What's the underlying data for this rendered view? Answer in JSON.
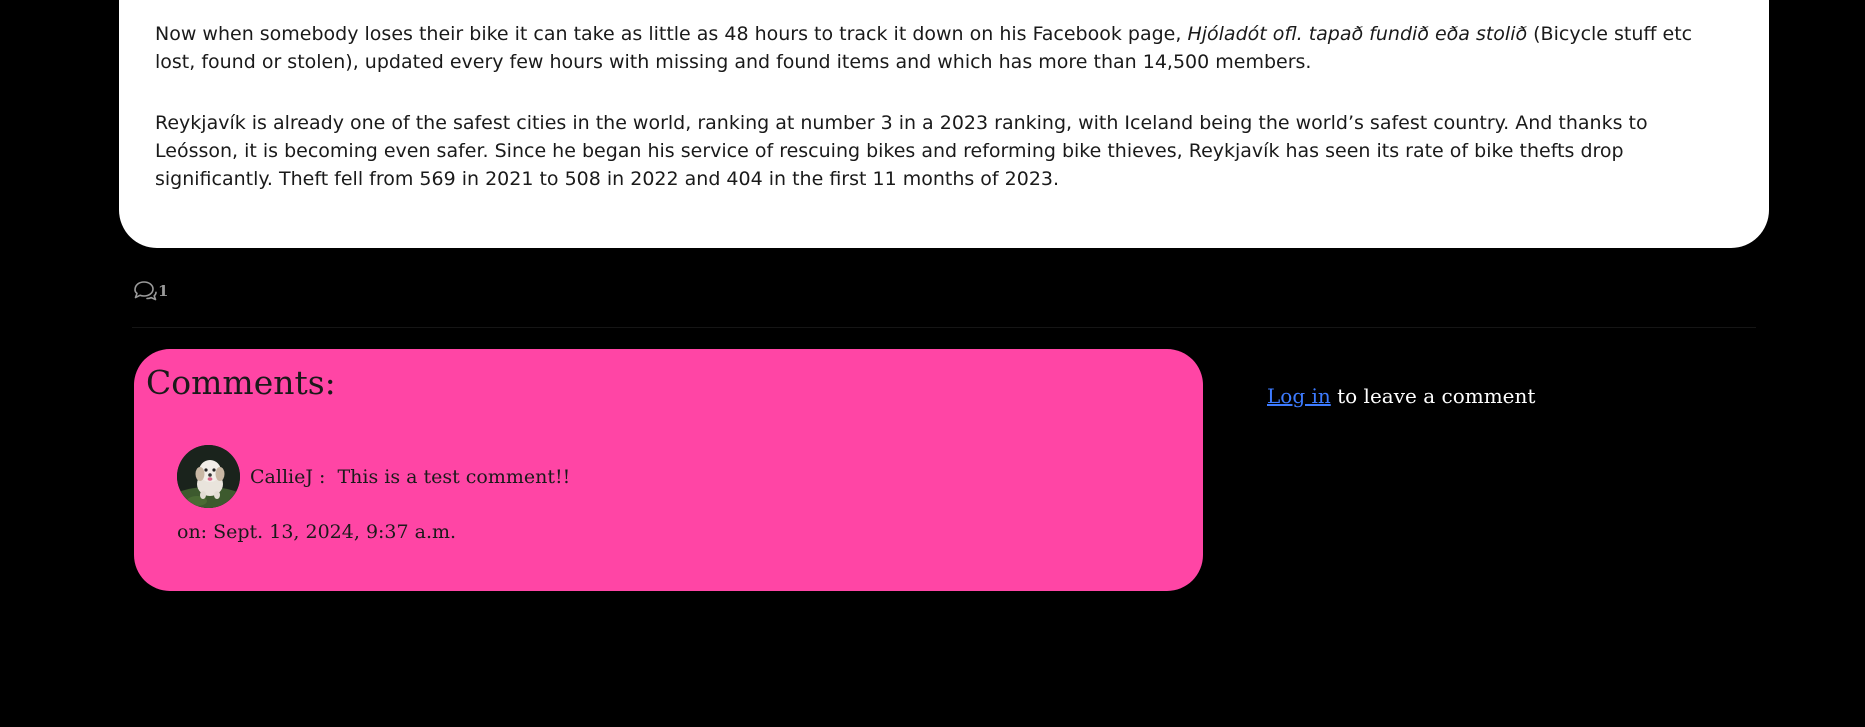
{
  "article": {
    "p1_before": "Now when somebody loses their bike it can take as little as 48 hours to track it down on his Facebook page, ",
    "p1_italic": "Hjóladót ofl. tapað fundið eða stolið",
    "p1_after": " (Bicycle stuff etc lost, found or stolen), updated every few hours with missing and found items and which has more than 14,500 members.",
    "p2": "Reykjavík is already one of the safest cities in the world, ranking at number 3 in a 2023 ranking, with Iceland being the world’s safest country. And thanks to Leósson, it is becoming even safer. Since he began his service of rescuing bikes and reforming bike thieves, Reykjavík has seen its rate of bike thefts drop significantly. Theft fell from 569 in 2021 to 508 in 2022 and 404 in the first 11 months of 2023."
  },
  "comment_count": {
    "icon": "comments-icon",
    "value": "1"
  },
  "comments": {
    "title": "Comments:",
    "items": [
      {
        "text": "CallieJ :  This is a test comment!!",
        "date": "on: Sept. 13, 2024, 9:37 a.m.",
        "avatar": "dog-avatar"
      }
    ]
  },
  "login": {
    "link_label": "Log in",
    "suffix": " to leave a comment"
  },
  "colors": {
    "background": "#000000",
    "card": "#ffffff",
    "comments_panel": "#ff45a5",
    "link": "#3d7bff"
  }
}
